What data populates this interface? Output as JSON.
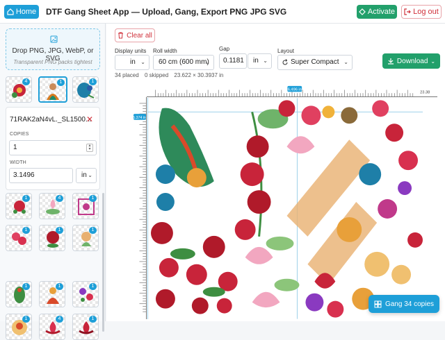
{
  "header": {
    "home_label": "Home",
    "title": "DTF Gang Sheet App — Upload, Gang, Export PNG JPG SVG",
    "activate_label": "Activate",
    "logout_label": "Log out"
  },
  "sidebar": {
    "dropzone_title": "Drop PNG, JPG, WebP, or SVG",
    "dropzone_sub": "Transparent PNG packs tightest",
    "top_thumbs": [
      {
        "badge": "4",
        "icon": "red-flower-icon"
      },
      {
        "badge": "1",
        "icon": "lady-figure-icon"
      },
      {
        "badge": "1",
        "icon": "peacock-icon"
      }
    ],
    "selected": {
      "filename": "71RAK2aN4vL._SL1500...",
      "copies_label": "COPIES",
      "copies_value": "1",
      "width_label": "WIDTH",
      "width_value": "3.1496",
      "width_unit": "in"
    },
    "grid_thumbs": [
      {
        "badge": "1",
        "icon": "rose-icon"
      },
      {
        "badge": "4",
        "icon": "lotus-leaf-icon"
      },
      {
        "badge": "1",
        "icon": "floral-pattern-icon"
      },
      {
        "badge": "1",
        "icon": "roses-icon"
      },
      {
        "badge": "1",
        "icon": "red-rose-icon"
      },
      {
        "badge": "1",
        "icon": "lotus-pink-icon"
      },
      {
        "badge": "1",
        "icon": "parrot-icon"
      },
      {
        "badge": "1",
        "icon": "goddess-icon"
      },
      {
        "badge": "1",
        "icon": "flowers-purple-icon"
      },
      {
        "badge": "1",
        "icon": "lady-disc-icon"
      },
      {
        "badge": "4",
        "icon": "lotus-red-icon"
      },
      {
        "badge": "1",
        "icon": "lotus-red-2-icon"
      }
    ]
  },
  "main": {
    "clear_label": "Clear all",
    "display_units_label": "Display units",
    "display_units_value": "in",
    "roll_width_label": "Roll width",
    "roll_width_value": "60 cm (600 mm)",
    "gap_label": "Gap",
    "gap_value": "0.1181",
    "gap_unit": "in",
    "layout_label": "Layout",
    "layout_value": "Super Compact",
    "download_label": "Download",
    "stats": {
      "placed": "34 placed",
      "skipped": "0 skipped",
      "size": "23.622 × 30.3937 in"
    },
    "ruler_top_marker": "6.496 in",
    "ruler_top_end": "23.38",
    "ruler_left_marker": "5.374 in",
    "gang_label": "Gang 34 copies"
  },
  "colors": {
    "accent": "#1e9fd8",
    "success": "#22a06b",
    "danger": "#d0313b"
  }
}
